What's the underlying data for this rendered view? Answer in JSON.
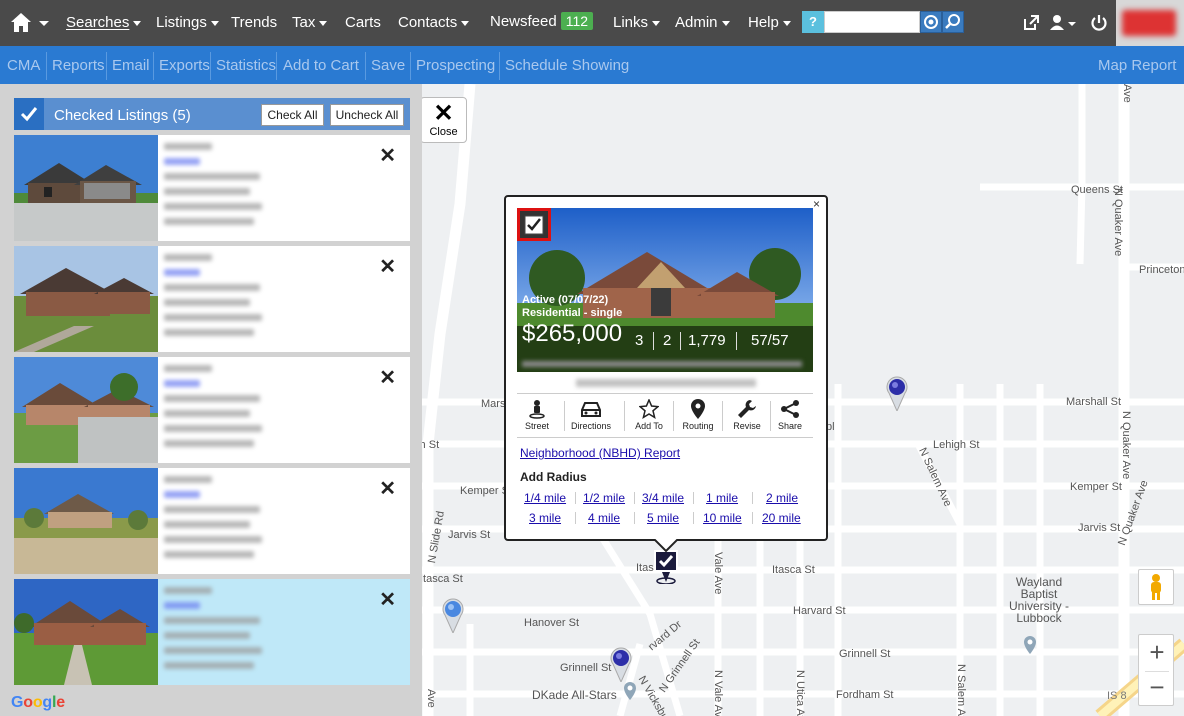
{
  "nav": {
    "items": [
      {
        "label": "Searches",
        "caret": true
      },
      {
        "label": "Listings",
        "caret": true
      },
      {
        "label": "Trends",
        "caret": false
      },
      {
        "label": "Tax",
        "caret": true
      },
      {
        "label": "Carts",
        "caret": false
      },
      {
        "label": "Contacts",
        "caret": true
      },
      {
        "label": "Newsfeed",
        "caret": false
      },
      {
        "label": "Links",
        "caret": true
      },
      {
        "label": "Admin",
        "caret": true
      },
      {
        "label": "Help",
        "caret": true
      }
    ],
    "newsfeed_count": "112",
    "search_help": "?"
  },
  "toolbar": {
    "items": [
      "CMA",
      "Reports",
      "Email",
      "Exports",
      "Statistics",
      "Add to Cart",
      "Save",
      "Prospecting",
      "Schedule Showing"
    ],
    "map_report": "Map Report"
  },
  "panel": {
    "title": "Checked Listings (5)",
    "check_all": "Check All",
    "uncheck_all": "Uncheck All"
  },
  "map": {
    "close_label": "Close",
    "streets": {
      "queens": "Queens St",
      "princeton": "Princeton",
      "marshall": "Marshall St",
      "marshall_left": "Mars",
      "lehigh": "Lehigh St",
      "lehigh_left": "igh St",
      "kemper_left": "Kemper St",
      "kemper_right": "Kemper St",
      "jarvis_left": "Jarvis St",
      "jarvis_right": "Jarvis St",
      "itasca_left": "Itasca St",
      "itasca_mid": "Itasca St",
      "itasca_short": "Itas",
      "harvard": "Harvard St",
      "hanover": "Hanover St",
      "grinnell_left": "Grinnell St",
      "grinnell_right": "Grinnell St",
      "fordham": "Fordham St",
      "n_quaker_1": "N Quaker Ave",
      "n_quaker_2": "N Quaker Ave",
      "n_quaker_3": "N Quaker Ave",
      "quaker_ave_top": "Ave",
      "n_salem_1": "N Salem Ave",
      "n_salem_2": "N Salem Ave",
      "vale_1": "Vale Ave",
      "vale_2": "N Vale Ave",
      "n_utica": "N Utica Ave",
      "slide": "N Slide Rd",
      "avenue_left": "Ave",
      "n_grinnell": "N Grinnell St",
      "n_vicksburg": "N Vicksburg",
      "harvard_dr": "rvard Dr",
      "pl": "pl",
      "wayland": "Wayland Baptist University - Lubbock",
      "dkade": "DKade All-Stars",
      "hwy": "IS 8"
    },
    "google": "Google"
  },
  "popup": {
    "status": "Active (07/07/22)",
    "type": "Residential - single",
    "price": "$265,000",
    "beds": "3",
    "baths": "2",
    "sqft": "1,779",
    "dom": "57/57",
    "actions": [
      "Street",
      "Directions",
      "Add To",
      "Routing",
      "Revise",
      "Share"
    ],
    "nbhd_report": "Neighborhood (NBHD) Report",
    "add_radius": "Add Radius",
    "radius_row1": [
      "1/4 mile",
      "1/2 mile",
      "3/4 mile",
      "1 mile",
      "2 mile"
    ],
    "radius_row2": [
      "3 mile",
      "4 mile",
      "5 mile",
      "10 mile",
      "20 mile"
    ],
    "close": "×"
  }
}
